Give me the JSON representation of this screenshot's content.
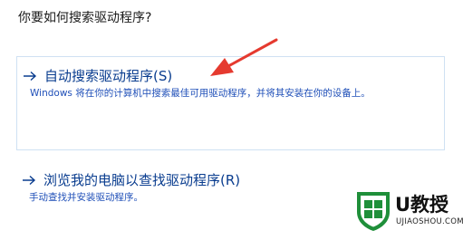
{
  "dialog": {
    "question": "你要如何搜索驱动程序?"
  },
  "options": [
    {
      "title": "自动搜索驱动程序(S)",
      "description": "Windows 将在你的计算机中搜索最佳可用驱动程序，并将其安装在你的设备上。",
      "icon": "arrow-right-icon"
    },
    {
      "title": "浏览我的电脑以查找驱动程序(R)",
      "description": "手动查找并安装驱动程序。",
      "icon": "arrow-right-icon"
    }
  ],
  "annotation": {
    "icon": "red-pointer-arrow-icon",
    "color": "#e53a2f"
  },
  "watermark": {
    "text": "U教授",
    "url": "UJIAOSHOU.COM",
    "logo_color": "#1f8f3a"
  },
  "colors": {
    "link": "#0a3d8f",
    "description": "#1f4fb8",
    "selection_border": "#cfe1f3"
  }
}
